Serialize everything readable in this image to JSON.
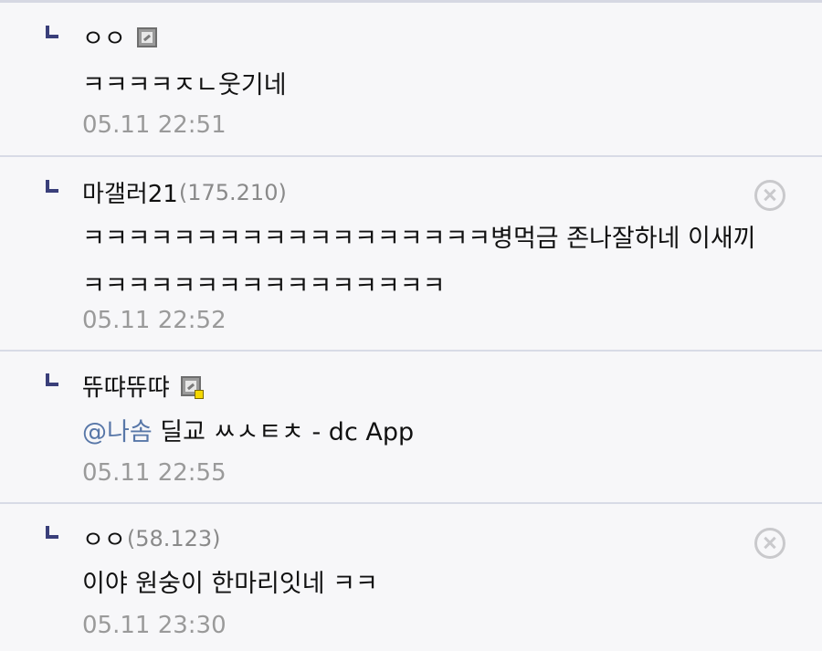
{
  "comments": [
    {
      "nickname": "ㅇㅇ",
      "ip": "",
      "icon": "fixed-member-icon",
      "text_lines": [
        "ㅋㅋㅋㅋㅈㄴ웃기네"
      ],
      "date": "05.11 22:51",
      "deletable": false
    },
    {
      "nickname": "마갤러21",
      "ip": "(175.210)",
      "icon": "",
      "text_lines": [
        "ㅋㅋㅋㅋㅋㅋㅋㅋㅋㅋㅋㅋㅋㅋㅋㅋㅋㅋ병먹금 존나잘하네 이새끼",
        "ㅋㅋㅋㅋㅋㅋㅋㅋㅋㅋㅋㅋㅋㅋㅋㅋ"
      ],
      "date": "05.11 22:52",
      "deletable": true
    },
    {
      "nickname": "뜌땨뜌땨",
      "ip": "",
      "icon": "half-fixed-member-icon",
      "mention": "@나솜",
      "text_lines": [
        " 딜교 ㅆㅅㅌㅊ - dc App"
      ],
      "date": "05.11 22:55",
      "deletable": false
    },
    {
      "nickname": "ㅇㅇ",
      "ip": "(58.123)",
      "icon": "",
      "text_lines": [
        "이야 원숭이 한마리잇네 ㅋㅋ"
      ],
      "date": "05.11 23:30",
      "deletable": true
    }
  ],
  "colors": {
    "background": "#f7f7f9",
    "divider": "#d8dbe6",
    "reply_marker": "#3a3f7a",
    "mention": "#5877a8",
    "meta_text": "#9a9a9a"
  }
}
